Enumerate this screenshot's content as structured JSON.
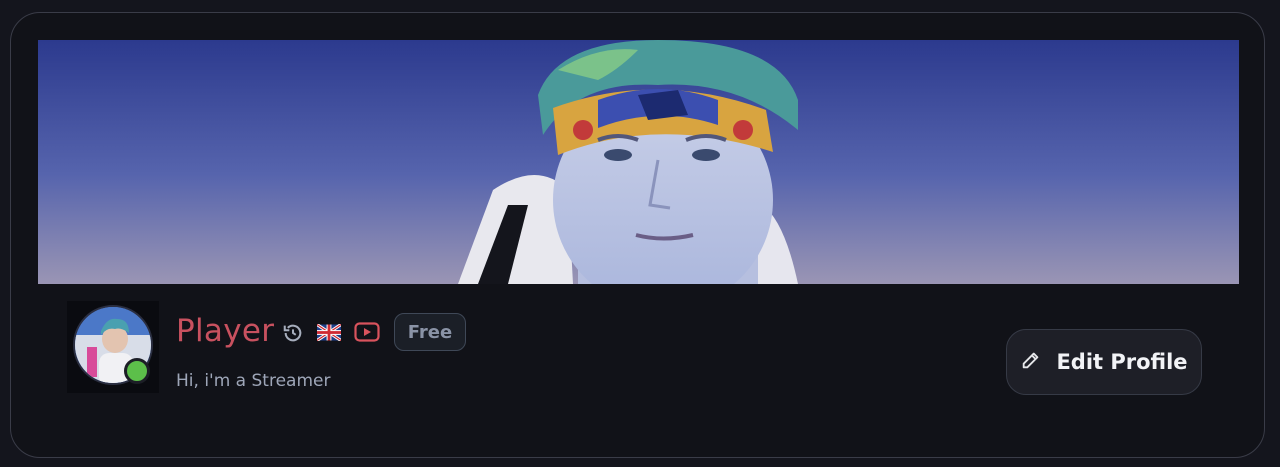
{
  "profile": {
    "name": "Player",
    "bio": "Hi, i'm a Streamer",
    "badge": "Free",
    "status": "online"
  },
  "actions": {
    "edit_profile_label": "Edit Profile"
  },
  "icons": {
    "history": "history-icon",
    "flag": "uk-flag-icon",
    "youtube": "youtube-icon",
    "edit": "pencil-icon"
  },
  "colors": {
    "name": "#c8515f",
    "status_online": "#5cbf4a",
    "badge_text": "#8a93a6"
  }
}
